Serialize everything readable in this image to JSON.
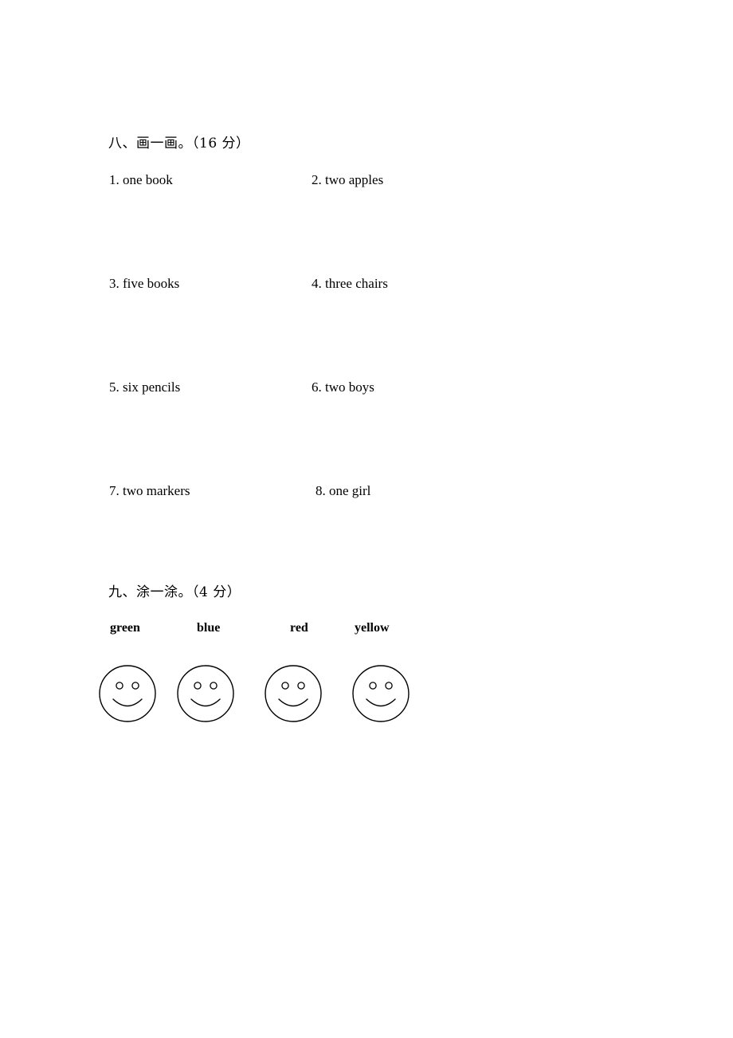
{
  "document": {
    "page_background": "#ffffff",
    "ink_color": "#000000"
  },
  "sections": {
    "draw": {
      "heading": "八、画一画。（16 分）",
      "number_label": "八",
      "title": "画一画",
      "points": "16 分",
      "items": [
        {
          "number": "1.",
          "text": "1. one book"
        },
        {
          "number": "2.",
          "text": "2. two apples"
        },
        {
          "number": "3.",
          "text": "3. five books"
        },
        {
          "number": "4.",
          "text": "4. three chairs"
        },
        {
          "number": "5.",
          "text": "5. six pencils"
        },
        {
          "number": "6.",
          "text": "6. two boys"
        },
        {
          "number": "7.",
          "text": "7. two markers"
        },
        {
          "number": "8.",
          "text": "8. one girl"
        }
      ]
    },
    "color": {
      "heading": "九、涂一涂。（4 分）",
      "number_label": "九",
      "title": "涂一涂",
      "points": "4 分",
      "words": [
        {
          "label": "green",
          "color": "#008000"
        },
        {
          "label": "blue",
          "color": "#0000ff"
        },
        {
          "label": "red",
          "color": "#ff0000"
        },
        {
          "label": "yellow",
          "color": "#ffff00"
        }
      ],
      "faces": [
        {
          "icon": "smiley-face-outline-icon"
        },
        {
          "icon": "smiley-face-outline-icon"
        },
        {
          "icon": "smiley-face-outline-icon"
        },
        {
          "icon": "smiley-face-outline-icon"
        }
      ]
    }
  }
}
